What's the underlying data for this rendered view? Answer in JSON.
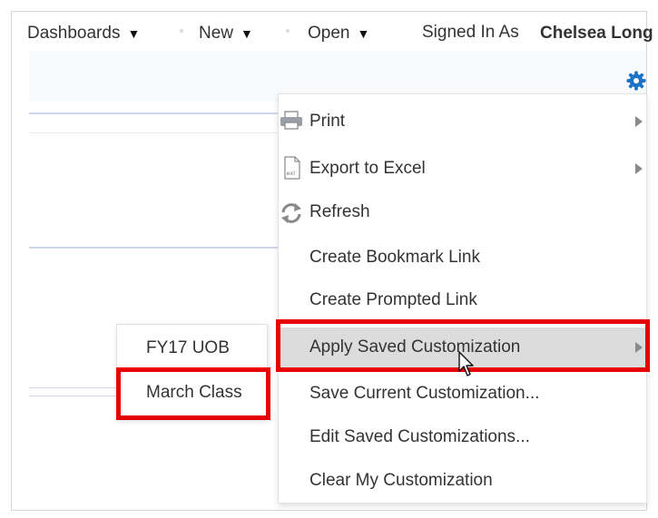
{
  "topbar": {
    "dashboards": "Dashboards",
    "new": "New",
    "open": "Open",
    "signed_in_label": "Signed In As",
    "user_name": "Chelsea Long"
  },
  "menu": {
    "print": "Print",
    "export_excel": "Export to Excel",
    "refresh": "Refresh",
    "create_bookmark": "Create Bookmark Link",
    "create_prompted": "Create Prompted Link",
    "apply_saved": "Apply Saved Customization",
    "save_current": "Save Current Customization...",
    "edit_saved": "Edit Saved Customizations...",
    "clear_my": "Clear My Customization"
  },
  "submenu": {
    "items": [
      "FY17 UOB",
      "March Class"
    ]
  },
  "colors": {
    "highlight_box": "#e60000",
    "gear": "#1a73c9",
    "menu_hover": "#dcdcdc"
  }
}
